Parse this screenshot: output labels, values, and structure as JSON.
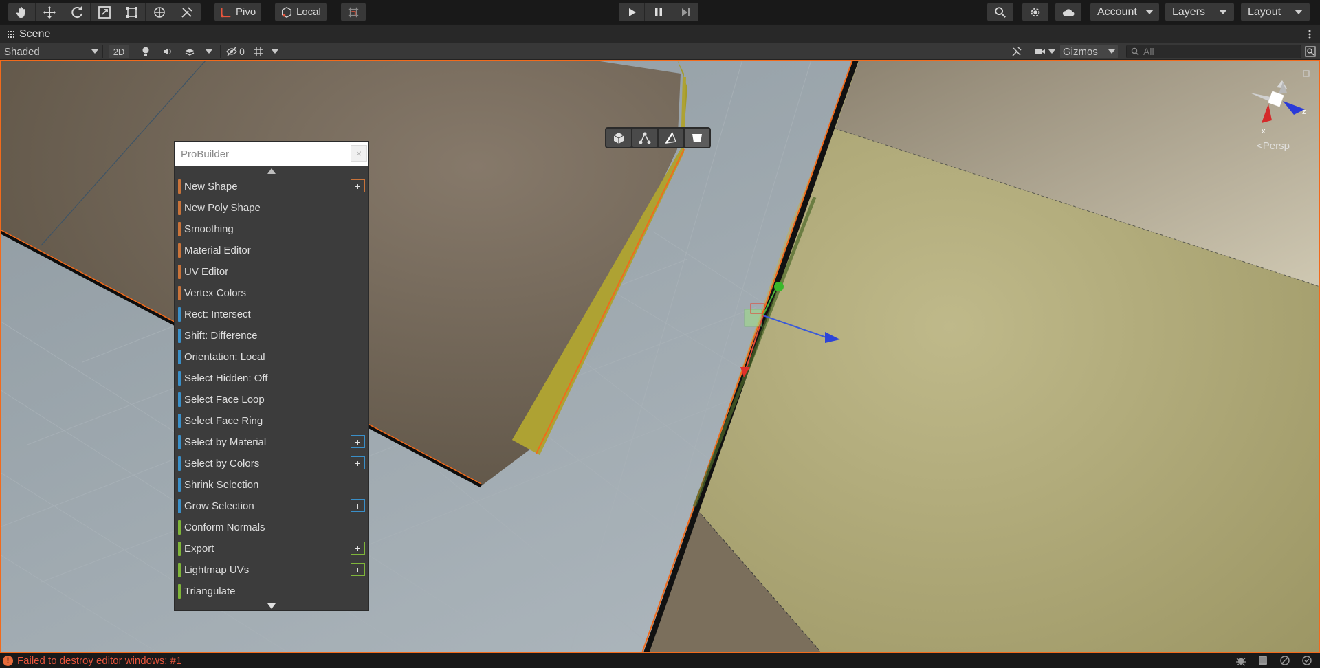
{
  "toolbar": {
    "pivot_label": "Pivo",
    "local_label": "Local",
    "account_label": "Account",
    "layers_label": "Layers",
    "layout_label": "Layout"
  },
  "tab": {
    "scene_label": "Scene"
  },
  "scenebar": {
    "shading_mode": "Shaded",
    "mode_2d": "2D",
    "hidden_count": "0",
    "gizmos_label": "Gizmos",
    "search_placeholder": "All"
  },
  "probuilder": {
    "title": "ProBuilder",
    "close_glyph": "×",
    "plus_glyph": "+",
    "items": [
      {
        "label": "New Shape",
        "color": "#c8733a",
        "plus": true
      },
      {
        "label": "New Poly Shape",
        "color": "#c8733a",
        "plus": false
      },
      {
        "label": "Smoothing",
        "color": "#c8733a",
        "plus": false
      },
      {
        "label": "Material Editor",
        "color": "#c8733a",
        "plus": false
      },
      {
        "label": "UV Editor",
        "color": "#c8733a",
        "plus": false
      },
      {
        "label": "Vertex Colors",
        "color": "#c8733a",
        "plus": false
      },
      {
        "label": "Rect: Intersect",
        "color": "#3a8fc8",
        "plus": false
      },
      {
        "label": "Shift: Difference",
        "color": "#3a8fc8",
        "plus": false
      },
      {
        "label": "Orientation: Local",
        "color": "#3a8fc8",
        "plus": false
      },
      {
        "label": "Select Hidden: Off",
        "color": "#3a8fc8",
        "plus": false
      },
      {
        "label": "Select Face Loop",
        "color": "#3a8fc8",
        "plus": false
      },
      {
        "label": "Select Face Ring",
        "color": "#3a8fc8",
        "plus": false
      },
      {
        "label": "Select by Material",
        "color": "#3a8fc8",
        "plus": true
      },
      {
        "label": "Select by Colors",
        "color": "#3a8fc8",
        "plus": true
      },
      {
        "label": "Shrink Selection",
        "color": "#3a8fc8",
        "plus": false
      },
      {
        "label": "Grow Selection",
        "color": "#3a8fc8",
        "plus": true
      },
      {
        "label": "Conform Normals",
        "color": "#7fb53a",
        "plus": false
      },
      {
        "label": "Export",
        "color": "#7fb53a",
        "plus": true
      },
      {
        "label": "Lightmap UVs",
        "color": "#7fb53a",
        "plus": true
      },
      {
        "label": "Triangulate",
        "color": "#7fb53a",
        "plus": false
      }
    ]
  },
  "viewport": {
    "persp_label": "<Persp",
    "axis_x_label": "x",
    "axis_z_label": "z"
  },
  "status": {
    "icon": "!",
    "message": "Failed to destroy editor windows: #1"
  }
}
